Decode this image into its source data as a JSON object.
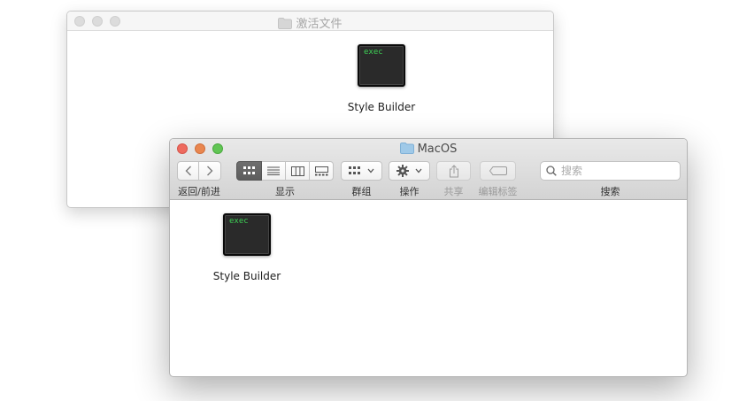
{
  "back_window": {
    "title": "激活文件",
    "files": [
      {
        "name": "Style Builder",
        "badge": "exec",
        "icon": "unix-executable-icon"
      }
    ]
  },
  "front_window": {
    "title": "MacOS",
    "toolbar": {
      "nav_label": "返回/前进",
      "view_label": "显示",
      "view_modes": [
        "icon-view",
        "list-view",
        "column-view",
        "gallery-view"
      ],
      "active_view": "icon-view",
      "group_label": "群组",
      "action_label": "操作",
      "share_label": "共享",
      "tags_label": "编辑标签",
      "search_label": "搜索",
      "search_placeholder": "搜索"
    },
    "files": [
      {
        "name": "Style Builder",
        "badge": "exec",
        "icon": "unix-executable-icon"
      }
    ]
  },
  "colors": {
    "close": "#ee6a5e",
    "minimize": "#f5bf4f",
    "zoom": "#61c554",
    "exec_text": "#3dd055",
    "folder": "#9fc9e8"
  }
}
